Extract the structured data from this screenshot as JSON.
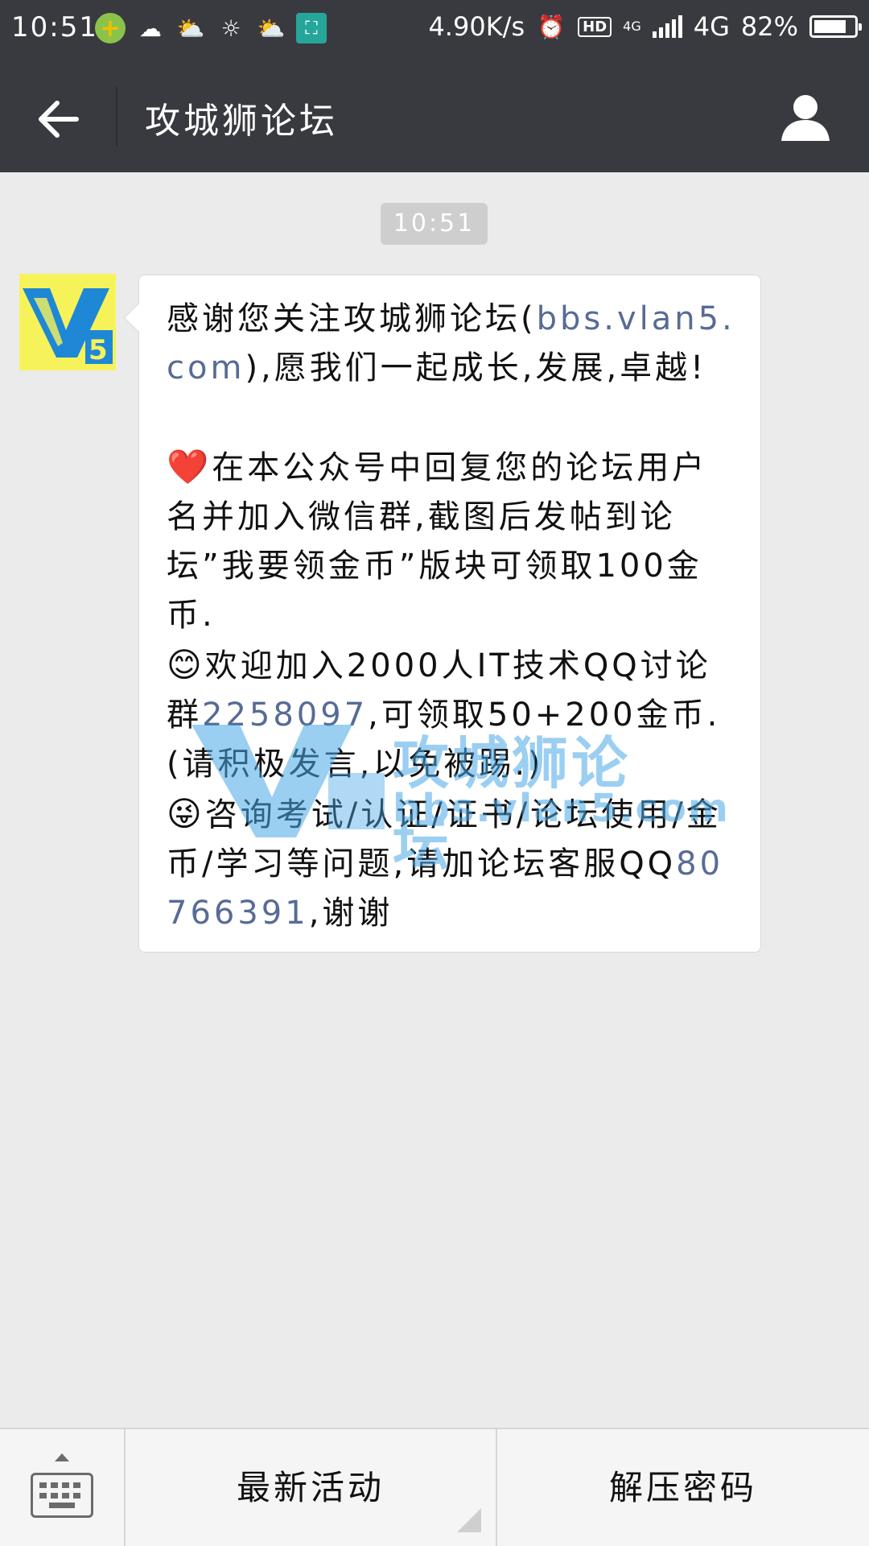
{
  "status_bar": {
    "time": "10:51",
    "net_speed": "4.90K/s",
    "hd_badge": "HD",
    "network_type_small": "4G",
    "network": "4G",
    "battery": "82%",
    "battery_level": 0.82
  },
  "header": {
    "title": "攻城狮论坛"
  },
  "chat": {
    "timestamp": "10:51",
    "message": {
      "p1_a": "感谢您关注攻城狮论坛(",
      "p1_link": "bbs.vlan5.com",
      "p1_b": "),愿我们一起成长,发展,卓越!",
      "p2_emoji": "❤️",
      "p2": "在本公众号中回复您的论坛用户名并加入微信群,截图后发帖到论坛”我要领金币”版块可领取100金币.",
      "p3_emoji": "😊",
      "p3_a": "欢迎加入2000人IT技术QQ讨论群",
      "p3_link": "2258097",
      "p3_b": ",可领取50+200金币.(请积极发言,以免被踢.)",
      "p4_emoji": "😜",
      "p4_a": "咨询考试/认证/证书/论坛使用/金币/学习等问题,请加论坛客服QQ",
      "p4_link": "80766391",
      "p4_b": ",谢谢"
    },
    "watermark": {
      "title": "攻城狮论坛",
      "url": "bbs.vlan5.com"
    }
  },
  "bottom_menu": {
    "items": [
      {
        "label": "最新活动"
      },
      {
        "label": "解压密码"
      }
    ]
  }
}
